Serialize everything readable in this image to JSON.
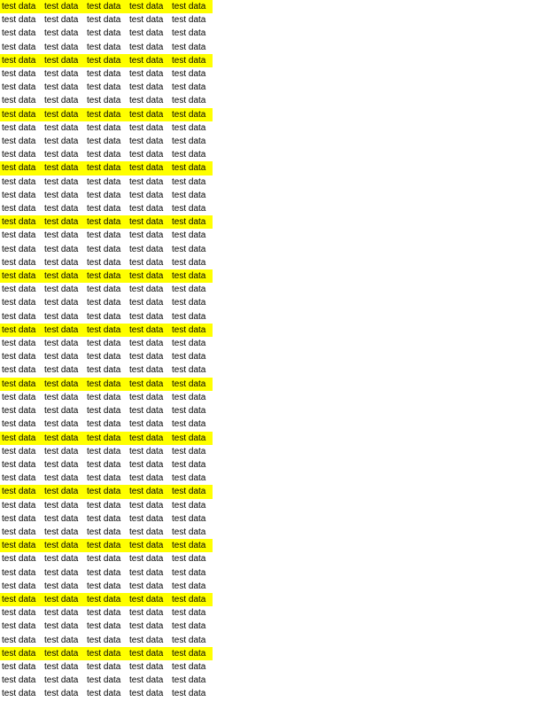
{
  "sheet": {
    "highlight_color": "#ffff00",
    "highlight_every": 4,
    "rows": [
      [
        "test data",
        "test data",
        "test data",
        "test data",
        "test data"
      ],
      [
        "test data",
        "test data",
        "test data",
        "test data",
        "test data"
      ],
      [
        "test data",
        "test data",
        "test data",
        "test data",
        "test data"
      ],
      [
        "test data",
        "test data",
        "test data",
        "test data",
        "test data"
      ],
      [
        "test data",
        "test data",
        "test data",
        "test data",
        "test data"
      ],
      [
        "test data",
        "test data",
        "test data",
        "test data",
        "test data"
      ],
      [
        "test data",
        "test data",
        "test data",
        "test data",
        "test data"
      ],
      [
        "test data",
        "test data",
        "test data",
        "test data",
        "test data"
      ],
      [
        "test data",
        "test data",
        "test data",
        "test data",
        "test data"
      ],
      [
        "test data",
        "test data",
        "test data",
        "test data",
        "test data"
      ],
      [
        "test data",
        "test data",
        "test data",
        "test data",
        "test data"
      ],
      [
        "test data",
        "test data",
        "test data",
        "test data",
        "test data"
      ],
      [
        "test data",
        "test data",
        "test data",
        "test data",
        "test data"
      ],
      [
        "test data",
        "test data",
        "test data",
        "test data",
        "test data"
      ],
      [
        "test data",
        "test data",
        "test data",
        "test data",
        "test data"
      ],
      [
        "test data",
        "test data",
        "test data",
        "test data",
        "test data"
      ],
      [
        "test data",
        "test data",
        "test data",
        "test data",
        "test data"
      ],
      [
        "test data",
        "test data",
        "test data",
        "test data",
        "test data"
      ],
      [
        "test data",
        "test data",
        "test data",
        "test data",
        "test data"
      ],
      [
        "test data",
        "test data",
        "test data",
        "test data",
        "test data"
      ],
      [
        "test data",
        "test data",
        "test data",
        "test data",
        "test data"
      ],
      [
        "test data",
        "test data",
        "test data",
        "test data",
        "test data"
      ],
      [
        "test data",
        "test data",
        "test data",
        "test data",
        "test data"
      ],
      [
        "test data",
        "test data",
        "test data",
        "test data",
        "test data"
      ],
      [
        "test data",
        "test data",
        "test data",
        "test data",
        "test data"
      ],
      [
        "test data",
        "test data",
        "test data",
        "test data",
        "test data"
      ],
      [
        "test data",
        "test data",
        "test data",
        "test data",
        "test data"
      ],
      [
        "test data",
        "test data",
        "test data",
        "test data",
        "test data"
      ],
      [
        "test data",
        "test data",
        "test data",
        "test data",
        "test data"
      ],
      [
        "test data",
        "test data",
        "test data",
        "test data",
        "test data"
      ],
      [
        "test data",
        "test data",
        "test data",
        "test data",
        "test data"
      ],
      [
        "test data",
        "test data",
        "test data",
        "test data",
        "test data"
      ],
      [
        "test data",
        "test data",
        "test data",
        "test data",
        "test data"
      ],
      [
        "test data",
        "test data",
        "test data",
        "test data",
        "test data"
      ],
      [
        "test data",
        "test data",
        "test data",
        "test data",
        "test data"
      ],
      [
        "test data",
        "test data",
        "test data",
        "test data",
        "test data"
      ],
      [
        "test data",
        "test data",
        "test data",
        "test data",
        "test data"
      ],
      [
        "test data",
        "test data",
        "test data",
        "test data",
        "test data"
      ],
      [
        "test data",
        "test data",
        "test data",
        "test data",
        "test data"
      ],
      [
        "test data",
        "test data",
        "test data",
        "test data",
        "test data"
      ],
      [
        "test data",
        "test data",
        "test data",
        "test data",
        "test data"
      ],
      [
        "test data",
        "test data",
        "test data",
        "test data",
        "test data"
      ],
      [
        "test data",
        "test data",
        "test data",
        "test data",
        "test data"
      ],
      [
        "test data",
        "test data",
        "test data",
        "test data",
        "test data"
      ],
      [
        "test data",
        "test data",
        "test data",
        "test data",
        "test data"
      ],
      [
        "test data",
        "test data",
        "test data",
        "test data",
        "test data"
      ],
      [
        "test data",
        "test data",
        "test data",
        "test data",
        "test data"
      ],
      [
        "test data",
        "test data",
        "test data",
        "test data",
        "test data"
      ],
      [
        "test data",
        "test data",
        "test data",
        "test data",
        "test data"
      ],
      [
        "test data",
        "test data",
        "test data",
        "test data",
        "test data"
      ],
      [
        "test data",
        "test data",
        "test data",
        "test data",
        "test data"
      ],
      [
        "test data",
        "test data",
        "test data",
        "test data",
        "test data"
      ]
    ]
  }
}
